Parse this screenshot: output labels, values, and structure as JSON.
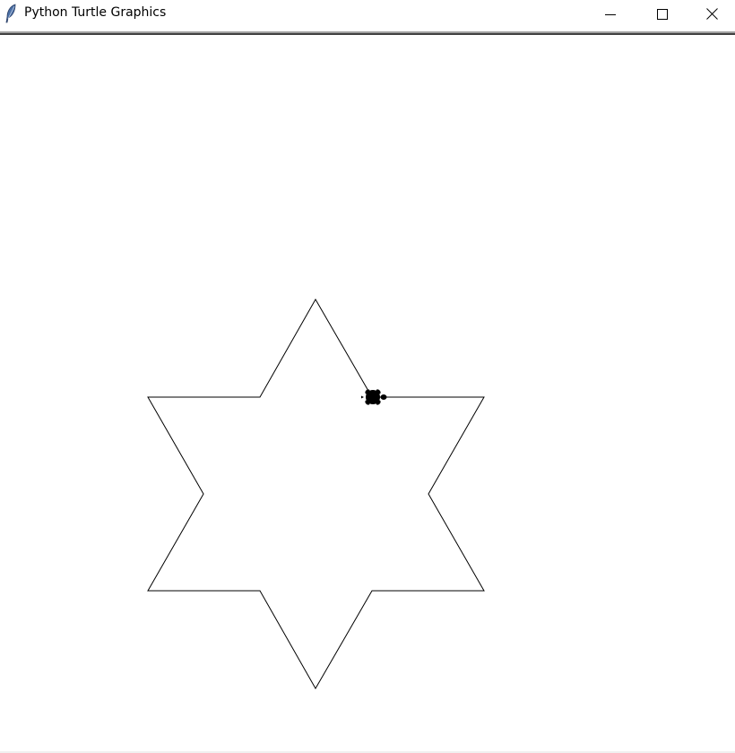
{
  "window": {
    "title": "Python Turtle Graphics",
    "icon": "feather-icon",
    "controls": {
      "minimize": "minimize-icon",
      "maximize": "maximize-icon",
      "close": "close-icon"
    }
  },
  "canvas": {
    "background": "#ffffff",
    "drawing": {
      "shape": "six-pointed star",
      "stroke": "#000000"
    },
    "turtle": {
      "shape": "turtle",
      "color": "#000000",
      "heading": "east"
    }
  }
}
